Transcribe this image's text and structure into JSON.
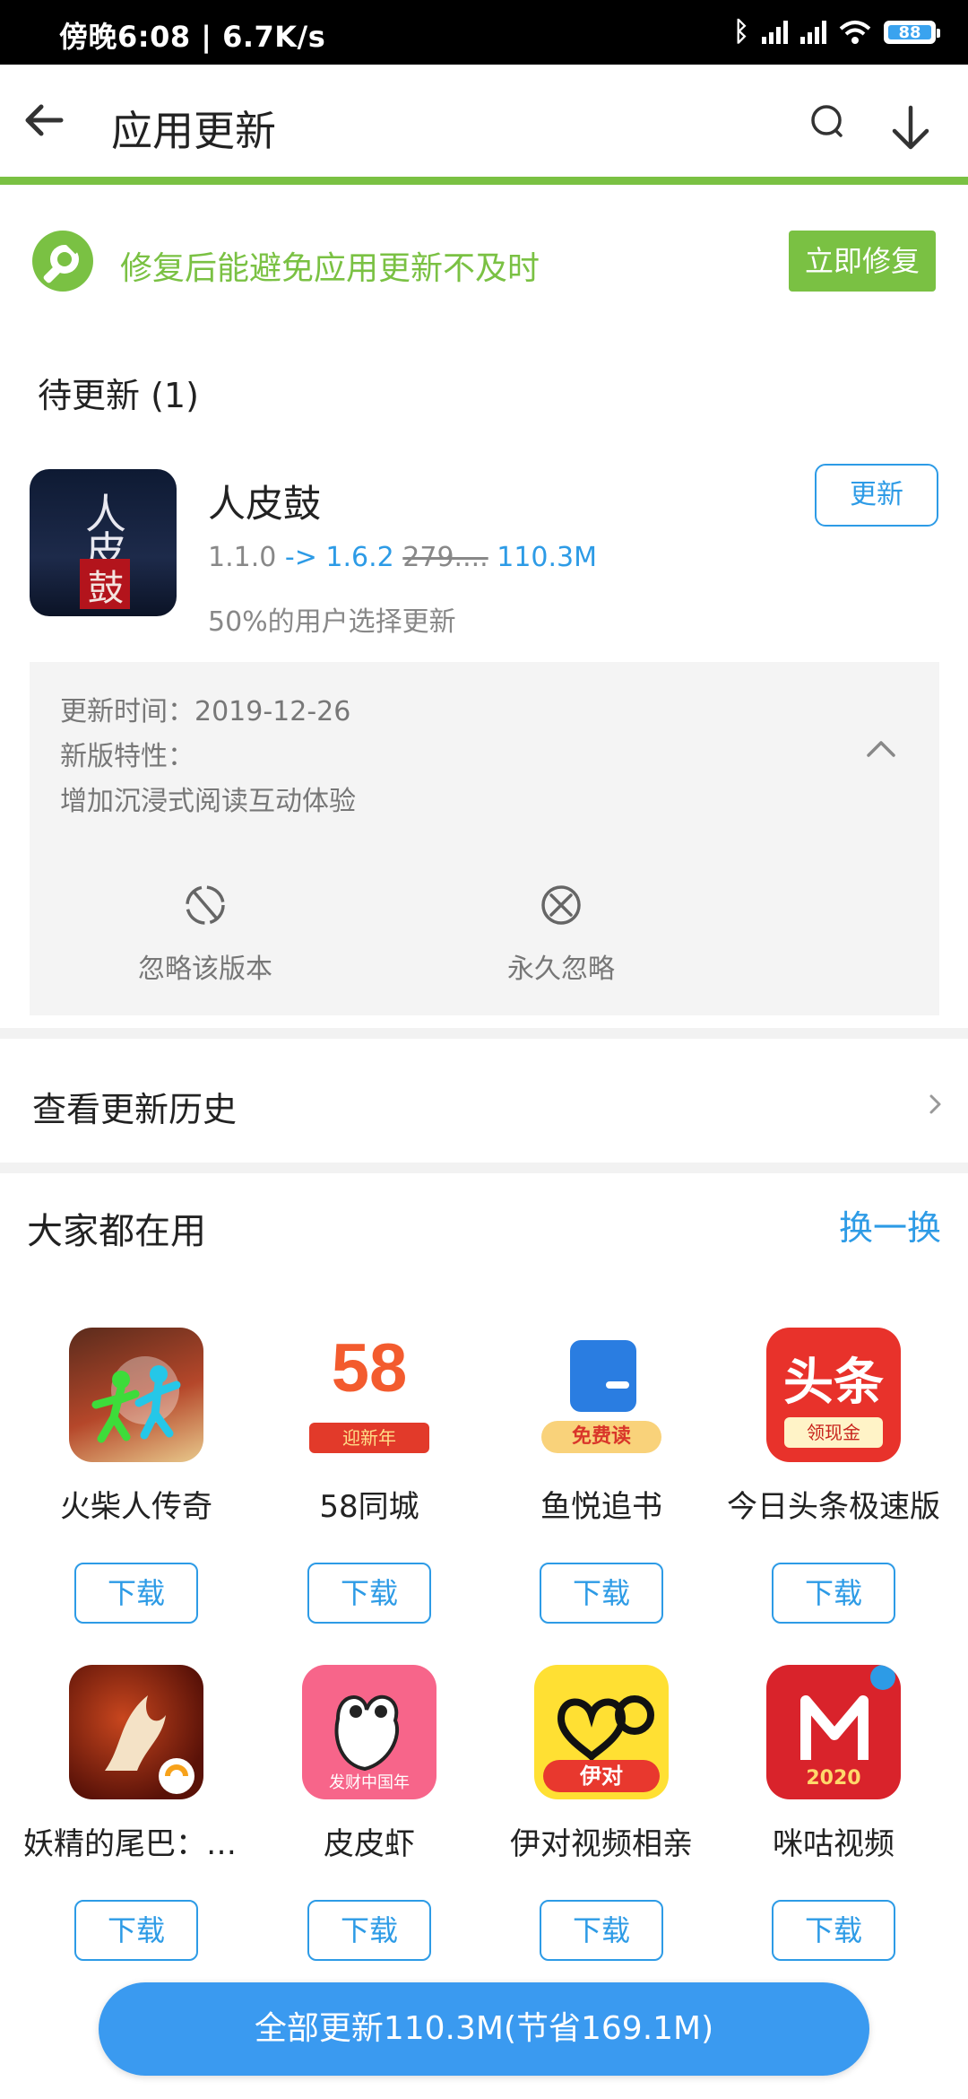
{
  "status_bar": {
    "time_speed": "傍晚6:08 | 6.7K/s",
    "bluetooth_icon": "bluetooth-icon",
    "battery": "88"
  },
  "header": {
    "title": "应用更新",
    "back_icon": "back-arrow-icon",
    "search_icon": "search-icon",
    "download_icon": "download-icon"
  },
  "banner": {
    "text": "修复后能避免应用更新不及时",
    "button": "立即修复"
  },
  "pending": {
    "heading": "待更新 (1)",
    "app": {
      "name": "人皮鼓",
      "icon_text": [
        "人",
        "皮",
        "鼓"
      ],
      "old_version": "1.1.0",
      "arrow_new": "-> 1.6.2",
      "old_size": "279....",
      "size": "110.3M",
      "users_note": "50%的用户选择更新",
      "update_button": "更新"
    },
    "details": {
      "update_time": "更新时间：2019-12-26",
      "features_label": "新版特性：",
      "features": "增加沉浸式阅读互动体验",
      "ignore_version": "忽略该版本",
      "ignore_forever": "永久忽略"
    }
  },
  "history": {
    "label": "查看更新历史"
  },
  "popular": {
    "title": "大家都在用",
    "shuffle": "换一换",
    "download_label": "下载",
    "apps": [
      {
        "name": "火柴人传奇"
      },
      {
        "name": "58同城",
        "badge": "58",
        "ribbon": "迎新年"
      },
      {
        "name": "鱼悦追书",
        "ribbon": "免费读"
      },
      {
        "name": "今日头条极速版",
        "badge": "头条",
        "ribbon": "领现金"
      },
      {
        "name": "妖精的尾巴：魔导少年"
      },
      {
        "name": "皮皮虾",
        "ribbon": "发财中国年"
      },
      {
        "name": "伊对视频相亲",
        "ribbon": "伊对"
      },
      {
        "name": "咪咕视频",
        "ribbon": "2020"
      }
    ]
  },
  "bottom": {
    "update_all": "全部更新110.3M(节省169.1M)"
  },
  "colors": {
    "accent_green": "#7ac143",
    "accent_blue": "#2d9be6",
    "button_blue": "#3a9af0"
  }
}
